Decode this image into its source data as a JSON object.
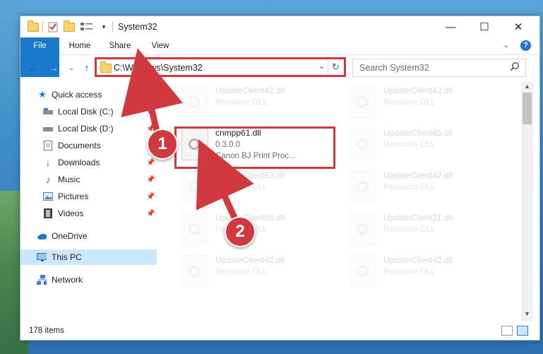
{
  "window": {
    "title": "System32"
  },
  "ribbon": {
    "tabs": [
      "File",
      "Home",
      "Share",
      "View"
    ]
  },
  "address": {
    "path": "C:\\Windows\\System32"
  },
  "search": {
    "placeholder": "Search System32"
  },
  "nav": {
    "items": [
      {
        "label": "Quick access",
        "icon": "star-icon",
        "pinned": false
      },
      {
        "label": "Local Disk (C:)",
        "icon": "drive-icon",
        "pinned": true
      },
      {
        "label": "Local Disk (D:)",
        "icon": "drive-icon",
        "pinned": true
      },
      {
        "label": "Documents",
        "icon": "documents-icon",
        "pinned": true
      },
      {
        "label": "Downloads",
        "icon": "download-arrow-icon",
        "pinned": true
      },
      {
        "label": "Music",
        "icon": "music-note-icon",
        "pinned": true
      },
      {
        "label": "Pictures",
        "icon": "pictures-icon",
        "pinned": true
      },
      {
        "label": "Videos",
        "icon": "film-icon",
        "pinned": true
      },
      {
        "label": "OneDrive",
        "icon": "cloud-icon",
        "pinned": false
      },
      {
        "label": "This PC",
        "icon": "monitor-icon",
        "pinned": false,
        "selected": true
      },
      {
        "label": "Network",
        "icon": "network-icon",
        "pinned": false
      }
    ]
  },
  "files": {
    "highlighted": {
      "name": "cnmpp61.dll",
      "version": "0.3.0.0",
      "description": "Canon BJ Print Proc..."
    },
    "left_column": [
      {
        "name": "UpdateClient42.dll",
        "type": "Resource DLL"
      },
      {
        "name": "UpdateClient63.dll",
        "type": "Resource DLL"
      },
      {
        "name": "UpdateClient65.dll",
        "type": "Resource DLL"
      },
      {
        "name": "UpdateClient42.dll",
        "type": "Resource DLL"
      }
    ],
    "right_column": [
      {
        "name": "UpdateClient42.dll",
        "type": "Resource DLL"
      },
      {
        "name": "UpdateClient65.dll",
        "type": "Resource DLL"
      },
      {
        "name": "UpdateClient42.dll",
        "type": "Resource DLL"
      },
      {
        "name": "UpdateClient21.dll",
        "type": "Resource DLL"
      },
      {
        "name": "UpdateClient42.dll",
        "type": "Resource DLL"
      }
    ]
  },
  "status": {
    "item_count": "178 items"
  },
  "callouts": {
    "one": "1",
    "two": "2"
  },
  "colors": {
    "accent": "#1979ca",
    "highlight": "#d0393e",
    "selected_bg": "#cce8ff"
  }
}
